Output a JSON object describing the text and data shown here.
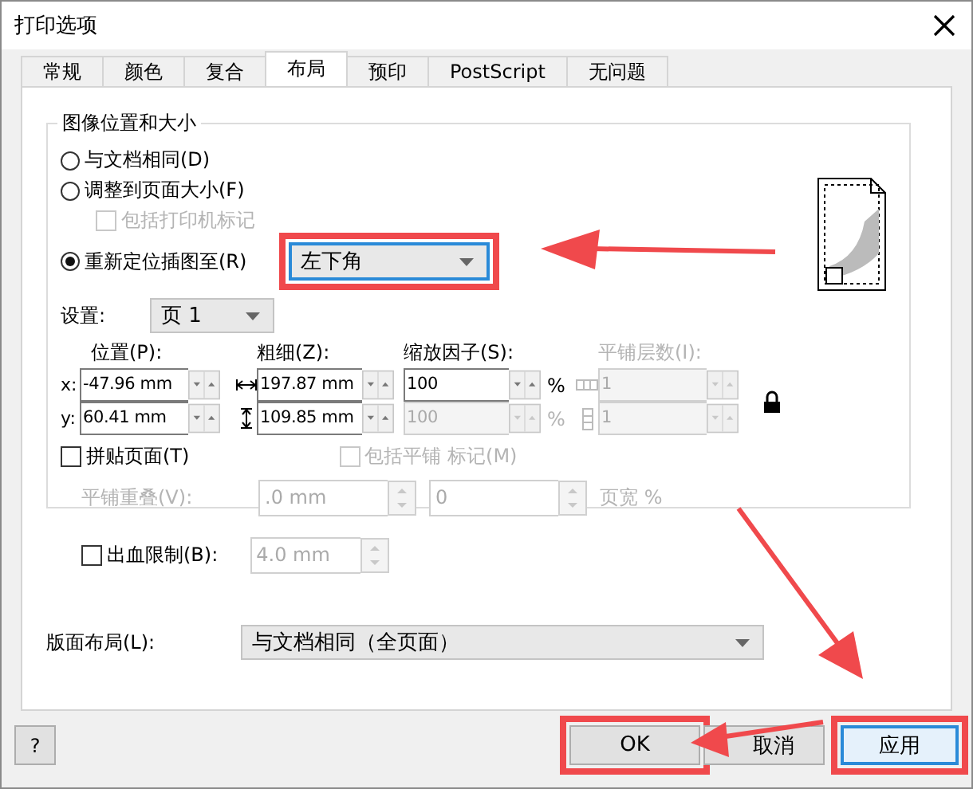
{
  "window": {
    "title": "打印选项"
  },
  "tabs": [
    {
      "label": "常规",
      "selected": false
    },
    {
      "label": "颜色",
      "selected": false
    },
    {
      "label": "复合",
      "selected": false
    },
    {
      "label": "布局",
      "selected": true
    },
    {
      "label": "预印",
      "selected": false
    },
    {
      "label": "PostScript",
      "selected": false
    },
    {
      "label": "无问题",
      "selected": false
    }
  ],
  "image_group": {
    "title": "图像位置和大小",
    "options": [
      {
        "kind": "radio",
        "label": "与文档相同(D)",
        "selected": false
      },
      {
        "kind": "radio",
        "label": "调整到页面大小(F)",
        "selected": false
      },
      {
        "kind": "checkbox",
        "label": "包括打印机标记",
        "checked": false,
        "disabled": true
      },
      {
        "kind": "radio",
        "label": "重新定位插图至(R)",
        "selected": true
      }
    ],
    "reposition": {
      "value": "左下角",
      "callout": true
    },
    "settings": {
      "label": "设置:",
      "value": "页 1"
    },
    "columns": [
      {
        "label": "位置(P):",
        "disabled": false
      },
      {
        "label": "粗细(Z):",
        "disabled": false
      },
      {
        "label": "缩放因子(S):",
        "disabled": false
      },
      {
        "label": "平铺层数(I):",
        "disabled": true
      }
    ],
    "rows": [
      {
        "axis": "x:",
        "position": "-47.96 mm",
        "size": "197.87 mm",
        "scale": "100",
        "scale_unit": "%",
        "scale_disabled": false,
        "tiles": "1",
        "tiles_disabled": true
      },
      {
        "axis": "y:",
        "position": "60.41 mm",
        "size": "109.85 mm",
        "scale": "100",
        "scale_unit": "%",
        "scale_disabled": true,
        "tiles": "1",
        "tiles_disabled": true
      }
    ],
    "tile_pages": {
      "label": "拼贴页面(T)",
      "checked": false
    },
    "tile_marks": {
      "label": "包括平铺 标记(M)",
      "checked": false,
      "disabled": true
    },
    "overlap": {
      "label": "平铺重叠(V):",
      "value": ".0 mm",
      "value_2": "0",
      "unit": "页宽 %",
      "disabled": true
    }
  },
  "bleed": {
    "label": "出血限制(B):",
    "checked": false,
    "value": "4.0 mm",
    "value_disabled": true
  },
  "imposition": {
    "label": "版面布局(L):",
    "value": "与文档相同（全页面）"
  },
  "buttons": [
    {
      "kind": "help",
      "label": "?",
      "callout": false,
      "focused": false
    },
    {
      "kind": "ok",
      "label": "OK",
      "callout": true,
      "focused": false
    },
    {
      "kind": "cancel",
      "label": "取消",
      "callout": false,
      "focused": false
    },
    {
      "kind": "apply",
      "label": "应用",
      "callout": true,
      "focused": true
    }
  ]
}
